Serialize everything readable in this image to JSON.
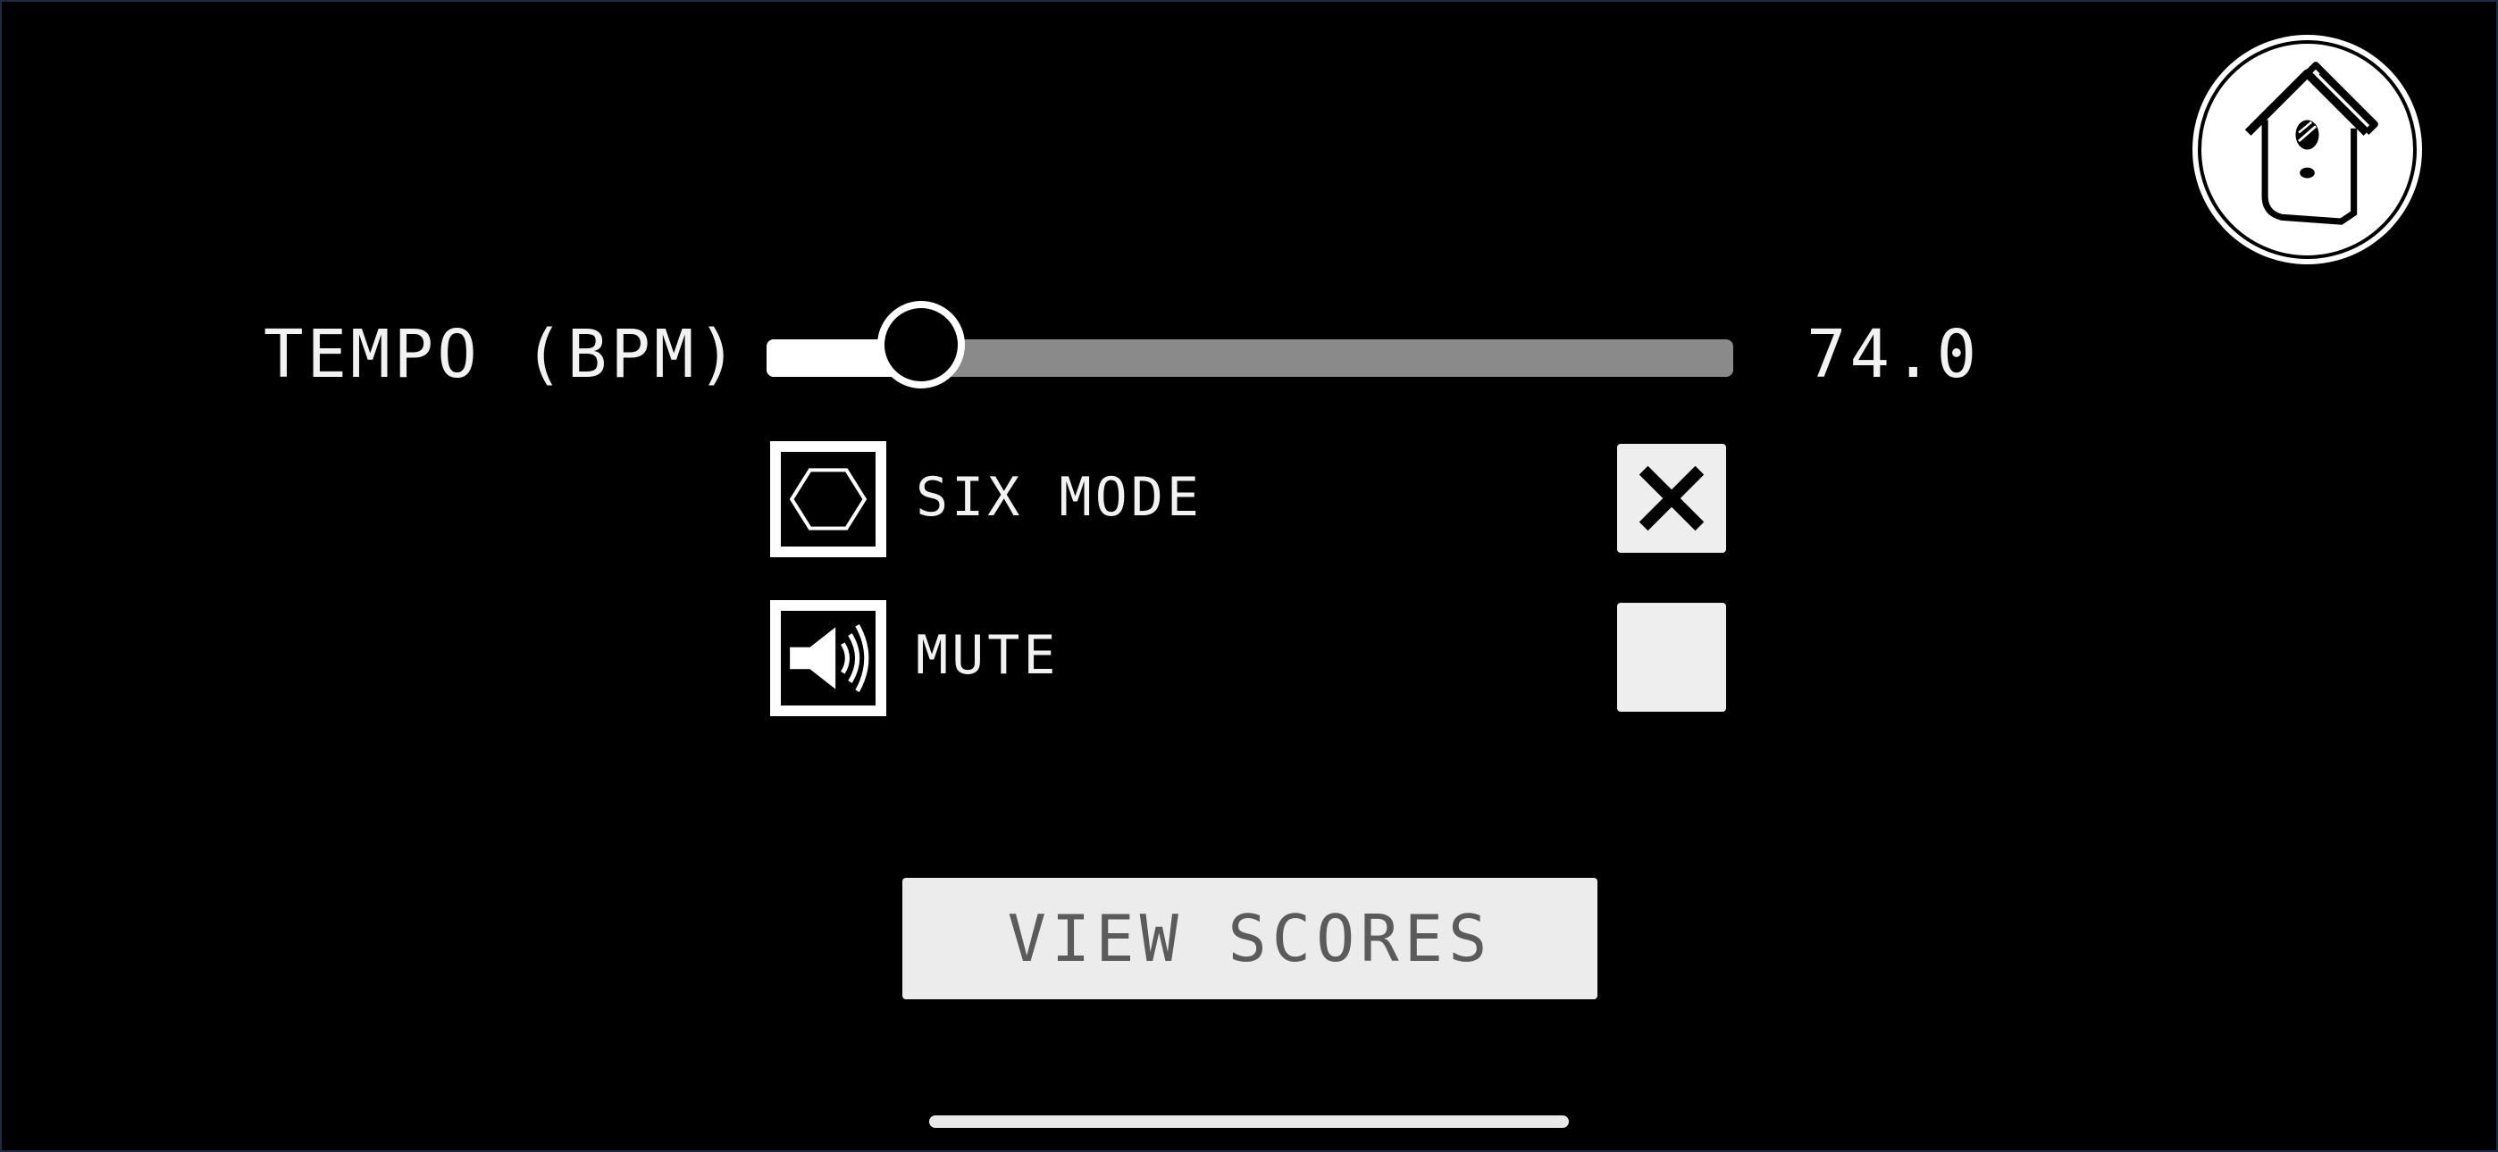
{
  "settings": {
    "tempo": {
      "label": "TEMPO (BPM)",
      "value_text": "74.0",
      "slider_fraction": 0.16
    },
    "six_mode": {
      "label": "SIX MODE",
      "icon": "hexagon-icon",
      "checked": true
    },
    "mute": {
      "label": "MUTE",
      "icon": "speaker-icon",
      "checked": false
    },
    "view_scores_label": "VIEW SCORES"
  },
  "header": {
    "home_icon": "birdhouse-icon"
  },
  "colors": {
    "background": "#000000",
    "foreground": "#ffffff",
    "slider_track": "#8a8a8a",
    "button_bg": "#ececec",
    "button_text": "#5b5b5b"
  }
}
